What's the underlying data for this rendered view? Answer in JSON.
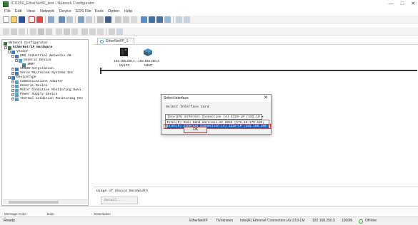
{
  "window": {
    "title": "ICD250_EtherNetIP_test - Network Configurator",
    "controls": [
      "—",
      "□",
      "✕"
    ]
  },
  "menu": [
    "File",
    "Edit",
    "View",
    "Network",
    "Device",
    "EDS File",
    "Tools",
    "Option",
    "Help"
  ],
  "colors": {
    "accent": "#0a64c8",
    "highlight_red": "#e23b3b",
    "status_online": "#3a9a3a"
  },
  "tree": {
    "items": [
      {
        "label": "Network Configurator",
        "level": 0,
        "icon": "network-icon"
      },
      {
        "label": "EtherNet/IP Hardware",
        "level": 1,
        "icon": "hardware-icon",
        "bold": true
      },
      {
        "label": "Vendor",
        "level": 2,
        "icon": "folder-icon"
      },
      {
        "label": "HMS Industrial Networks AB",
        "level": 3,
        "icon": "folder-icon"
      },
      {
        "label": "Generic Device",
        "level": 4,
        "icon": "device-icon"
      },
      {
        "label": "IMMT",
        "level": 5,
        "icon": "device-icon"
      },
      {
        "label": "OMRON Corporation",
        "level": 3,
        "icon": "folder-icon"
      },
      {
        "label": "Servo Microcosm Systems Inc",
        "level": 3,
        "icon": "folder-icon"
      },
      {
        "label": "DeviceType",
        "level": 2,
        "icon": "folder-icon"
      },
      {
        "label": "Communications Adapter",
        "level": 3,
        "icon": "device-icon"
      },
      {
        "label": "Generic Device",
        "level": 3,
        "icon": "device-icon"
      },
      {
        "label": "Motor Condition Monitoring Devi",
        "level": 3,
        "icon": "device-icon"
      },
      {
        "label": "Power Supply Device",
        "level": 3,
        "icon": "device-icon"
      },
      {
        "label": "Thermal Condition Monitoring Dev",
        "level": 3,
        "icon": "device-icon"
      }
    ]
  },
  "network_tab": {
    "label": "EtherNet/IP_1"
  },
  "devices": [
    {
      "ip": "192.168.250.1",
      "name": "NX1P2"
    },
    {
      "ip": "192.168.250.2",
      "name": "IMMT"
    }
  ],
  "usage": {
    "title": "Usage of Device Bandwidth",
    "value": "Detail..."
  },
  "bottom_columns": [
    "Message Code",
    "Date",
    "Description"
  ],
  "status": {
    "ready": "Ready",
    "network": "EtherNet/IP",
    "mode": "TUnknown",
    "interface": "Intel(R) Ethernet Connection (4) I219-LM",
    "ip": "192.168.250.5",
    "speed": "1000M",
    "state": "Off-line"
  },
  "dialog": {
    "title": "Select Interface",
    "close": "✕",
    "label": "Select Interface Card",
    "selected": "Intel(R) Ethernet Connection (4) I219-LM [192.16 ▾",
    "options": [
      "Intel(R) Dual Band Wireless-AC 8265 [172.16.176.103]",
      "Intel(R) Ethernet Connection (4) I219-LM [192.168.250.5]"
    ],
    "ok_label": "OK"
  }
}
